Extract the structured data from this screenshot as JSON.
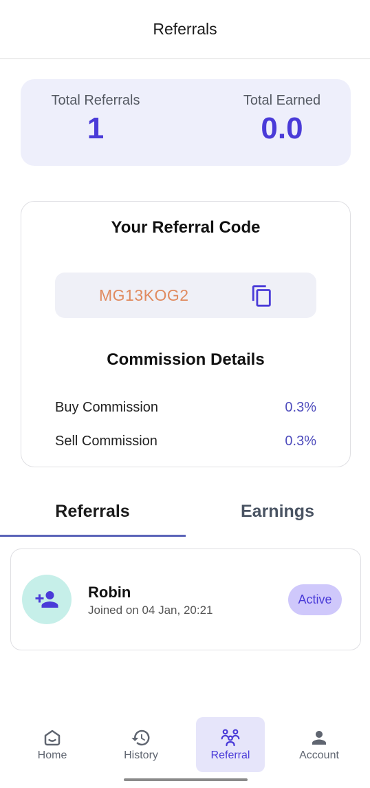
{
  "header": {
    "title": "Referrals"
  },
  "stats": {
    "total_referrals_label": "Total Referrals",
    "total_referrals_value": "1",
    "total_earned_label": "Total Earned",
    "total_earned_value": "0.0"
  },
  "referral_code": {
    "title": "Your Referral Code",
    "code": "MG13KOG2",
    "copy_icon": "copy-icon"
  },
  "commission": {
    "title": "Commission Details",
    "rows": [
      {
        "label": "Buy Commission",
        "value": "0.3%"
      },
      {
        "label": "Sell Commission",
        "value": "0.3%"
      }
    ]
  },
  "tabs": [
    {
      "label": "Referrals",
      "active": true
    },
    {
      "label": "Earnings",
      "active": false
    }
  ],
  "referrals": [
    {
      "name": "Robin",
      "joined": "Joined on 04 Jan, 20:21",
      "status": "Active",
      "icon": "add-person-icon"
    }
  ],
  "bottom_nav": [
    {
      "label": "Home",
      "icon": "home-icon",
      "active": false
    },
    {
      "label": "History",
      "icon": "history-icon",
      "active": false
    },
    {
      "label": "Referral",
      "icon": "group-icon",
      "active": true
    },
    {
      "label": "Account",
      "icon": "person-icon",
      "active": false
    }
  ],
  "colors": {
    "accent": "#4a3bd8",
    "code_text": "#e08a5f",
    "stats_background": "#eeeffb",
    "badge_background": "#cfc8fb",
    "avatar_background": "#c6efe9"
  }
}
